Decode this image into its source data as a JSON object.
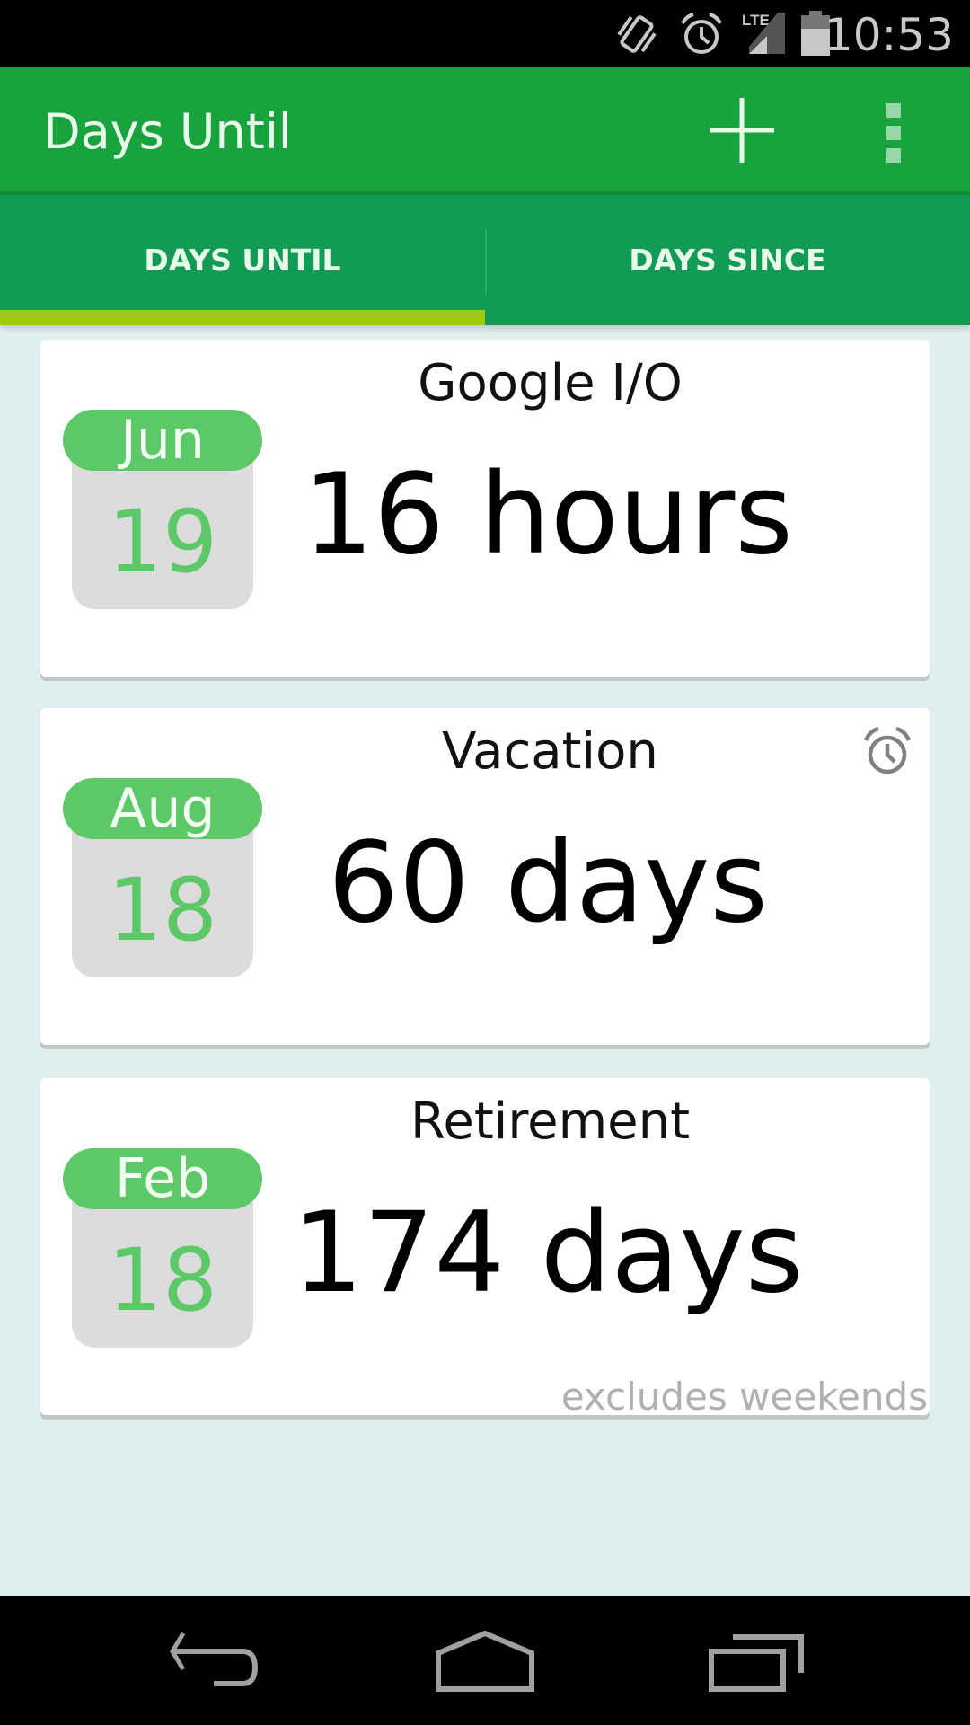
{
  "status_bar": {
    "icons": [
      "vibrate-icon",
      "alarm-icon",
      "lte-signal-icon",
      "battery-icon"
    ],
    "network_label": "LTE",
    "time": "10:53"
  },
  "action_bar": {
    "title": "Days Until",
    "add_icon": "plus-icon",
    "overflow_icon": "more-vert-icon"
  },
  "tabs": [
    {
      "label": "DAYS UNTIL",
      "selected": true
    },
    {
      "label": "DAYS SINCE",
      "selected": false
    }
  ],
  "events": [
    {
      "title": "Google I/O",
      "month": "Jun",
      "day": "19",
      "countdown": "16 hours",
      "has_alarm": false,
      "note": ""
    },
    {
      "title": "Vacation",
      "month": "Aug",
      "day": "18",
      "countdown": "60 days",
      "has_alarm": true,
      "note": ""
    },
    {
      "title": "Retirement",
      "month": "Feb",
      "day": "18",
      "countdown": "174 days",
      "has_alarm": false,
      "note": "excludes weekends"
    }
  ],
  "nav_bar": {
    "buttons": [
      "back-icon",
      "home-icon",
      "recents-icon"
    ]
  },
  "colors": {
    "action_bar": "#19a33f",
    "tab_bar": "#129b55",
    "tab_indicator": "#9dcb0b",
    "calendar_green": "#5dc868",
    "background": "#dfeeee"
  }
}
